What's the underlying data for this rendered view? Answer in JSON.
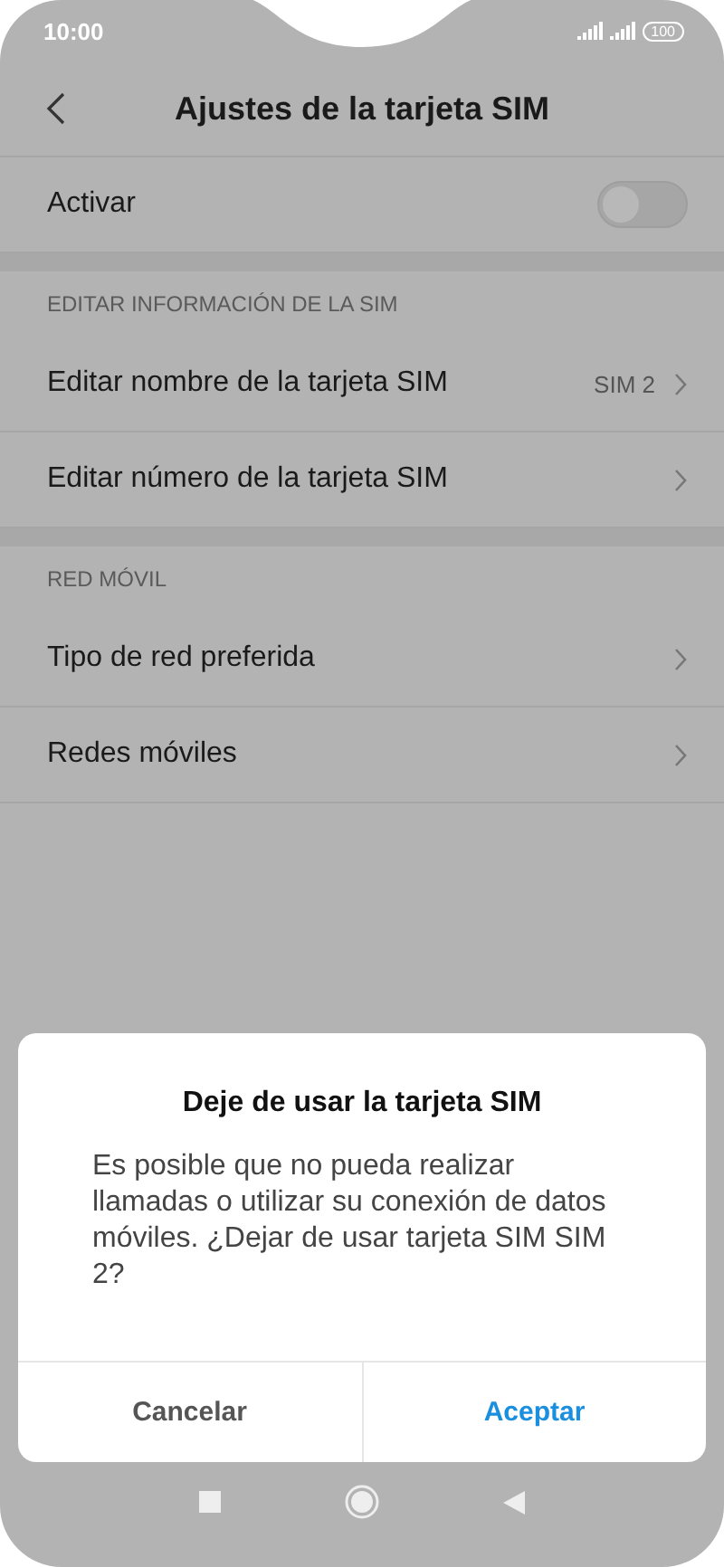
{
  "status_bar": {
    "time": "10:00",
    "battery": "100"
  },
  "header": {
    "title": "Ajustes de la tarjeta SIM"
  },
  "sections": [
    {
      "items": [
        {
          "kind": "toggle",
          "label": "Activar",
          "on": false
        }
      ]
    },
    {
      "heading": "EDITAR INFORMACIÓN DE LA SIM",
      "items": [
        {
          "kind": "link",
          "label": "Editar nombre de la tarjeta SIM",
          "value": "SIM 2"
        },
        {
          "kind": "link",
          "label": "Editar número de la tarjeta SIM"
        }
      ]
    },
    {
      "heading": "RED MÓVIL",
      "items": [
        {
          "kind": "link",
          "label": "Tipo de red preferida"
        },
        {
          "kind": "link",
          "label": "Redes móviles"
        }
      ]
    }
  ],
  "dialog": {
    "title": "Deje de usar la tarjeta SIM",
    "message": "Es posible que no pueda realizar llamadas o utilizar su conexión de datos móviles. ¿Dejar de usar tarjeta SIM SIM 2?",
    "buttons": [
      {
        "label": "Cancelar",
        "primary": false
      },
      {
        "label": "Aceptar",
        "primary": true
      }
    ]
  }
}
